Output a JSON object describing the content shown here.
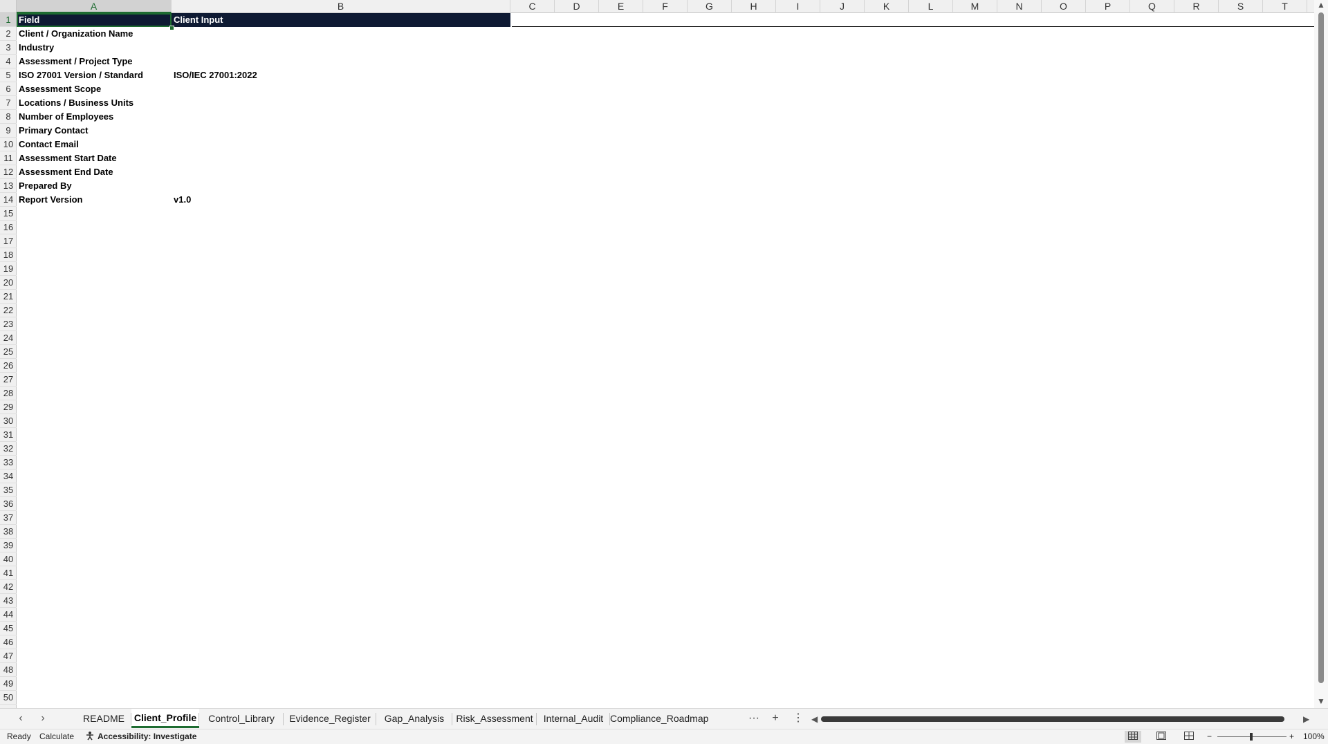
{
  "columns": [
    "A",
    "B",
    "C",
    "D",
    "E",
    "F",
    "G",
    "H",
    "I",
    "J",
    "K",
    "L",
    "M",
    "N",
    "O",
    "P",
    "Q",
    "R",
    "S",
    "T"
  ],
  "rows": [
    "1",
    "2",
    "3",
    "4",
    "5",
    "6",
    "7",
    "8",
    "9",
    "10",
    "11",
    "12",
    "13",
    "14",
    "15",
    "16",
    "17",
    "18",
    "19",
    "20",
    "21",
    "22",
    "23",
    "24",
    "25",
    "26",
    "27",
    "28",
    "29",
    "30",
    "31",
    "32",
    "33",
    "34",
    "35",
    "36",
    "37",
    "38",
    "39",
    "40",
    "41",
    "42",
    "43",
    "44",
    "45",
    "46",
    "47",
    "48",
    "49",
    "50"
  ],
  "header": {
    "field": "Field",
    "client_input": "Client Input"
  },
  "fields": [
    {
      "label": "Client / Organization Name",
      "value": ""
    },
    {
      "label": "Industry",
      "value": ""
    },
    {
      "label": "Assessment / Project Type",
      "value": ""
    },
    {
      "label": "ISO 27001 Version / Standard",
      "value": "ISO/IEC 27001:2022"
    },
    {
      "label": "Assessment Scope",
      "value": ""
    },
    {
      "label": "Locations / Business Units",
      "value": ""
    },
    {
      "label": "Number of Employees",
      "value": ""
    },
    {
      "label": "Primary Contact",
      "value": ""
    },
    {
      "label": "Contact Email",
      "value": ""
    },
    {
      "label": "Assessment Start Date",
      "value": ""
    },
    {
      "label": "Assessment End Date",
      "value": ""
    },
    {
      "label": "Prepared By",
      "value": ""
    },
    {
      "label": "Report Version",
      "value": "v1.0"
    }
  ],
  "tabs": [
    "README",
    "Client_Profile",
    "Control_Library",
    "Evidence_Register",
    "Gap_Analysis",
    "Risk_Assessment",
    "Internal_Audit",
    "Compliance_Roadmap"
  ],
  "active_tab": "Client_Profile",
  "icons": {
    "prev": "‹",
    "next": "›",
    "more": "···",
    "add": "+",
    "options": "⋮",
    "scroll_left": "◀",
    "scroll_right": "▶",
    "scroll_up": "▲",
    "scroll_down": "▼",
    "zoom_out": "−",
    "zoom_in": "+"
  },
  "status": {
    "ready": "Ready",
    "calculate": "Calculate",
    "accessibility": "Accessibility: Investigate",
    "zoom": "100%"
  },
  "colors": {
    "header_fill": "#0e1a33",
    "accent": "#1e6c31"
  }
}
